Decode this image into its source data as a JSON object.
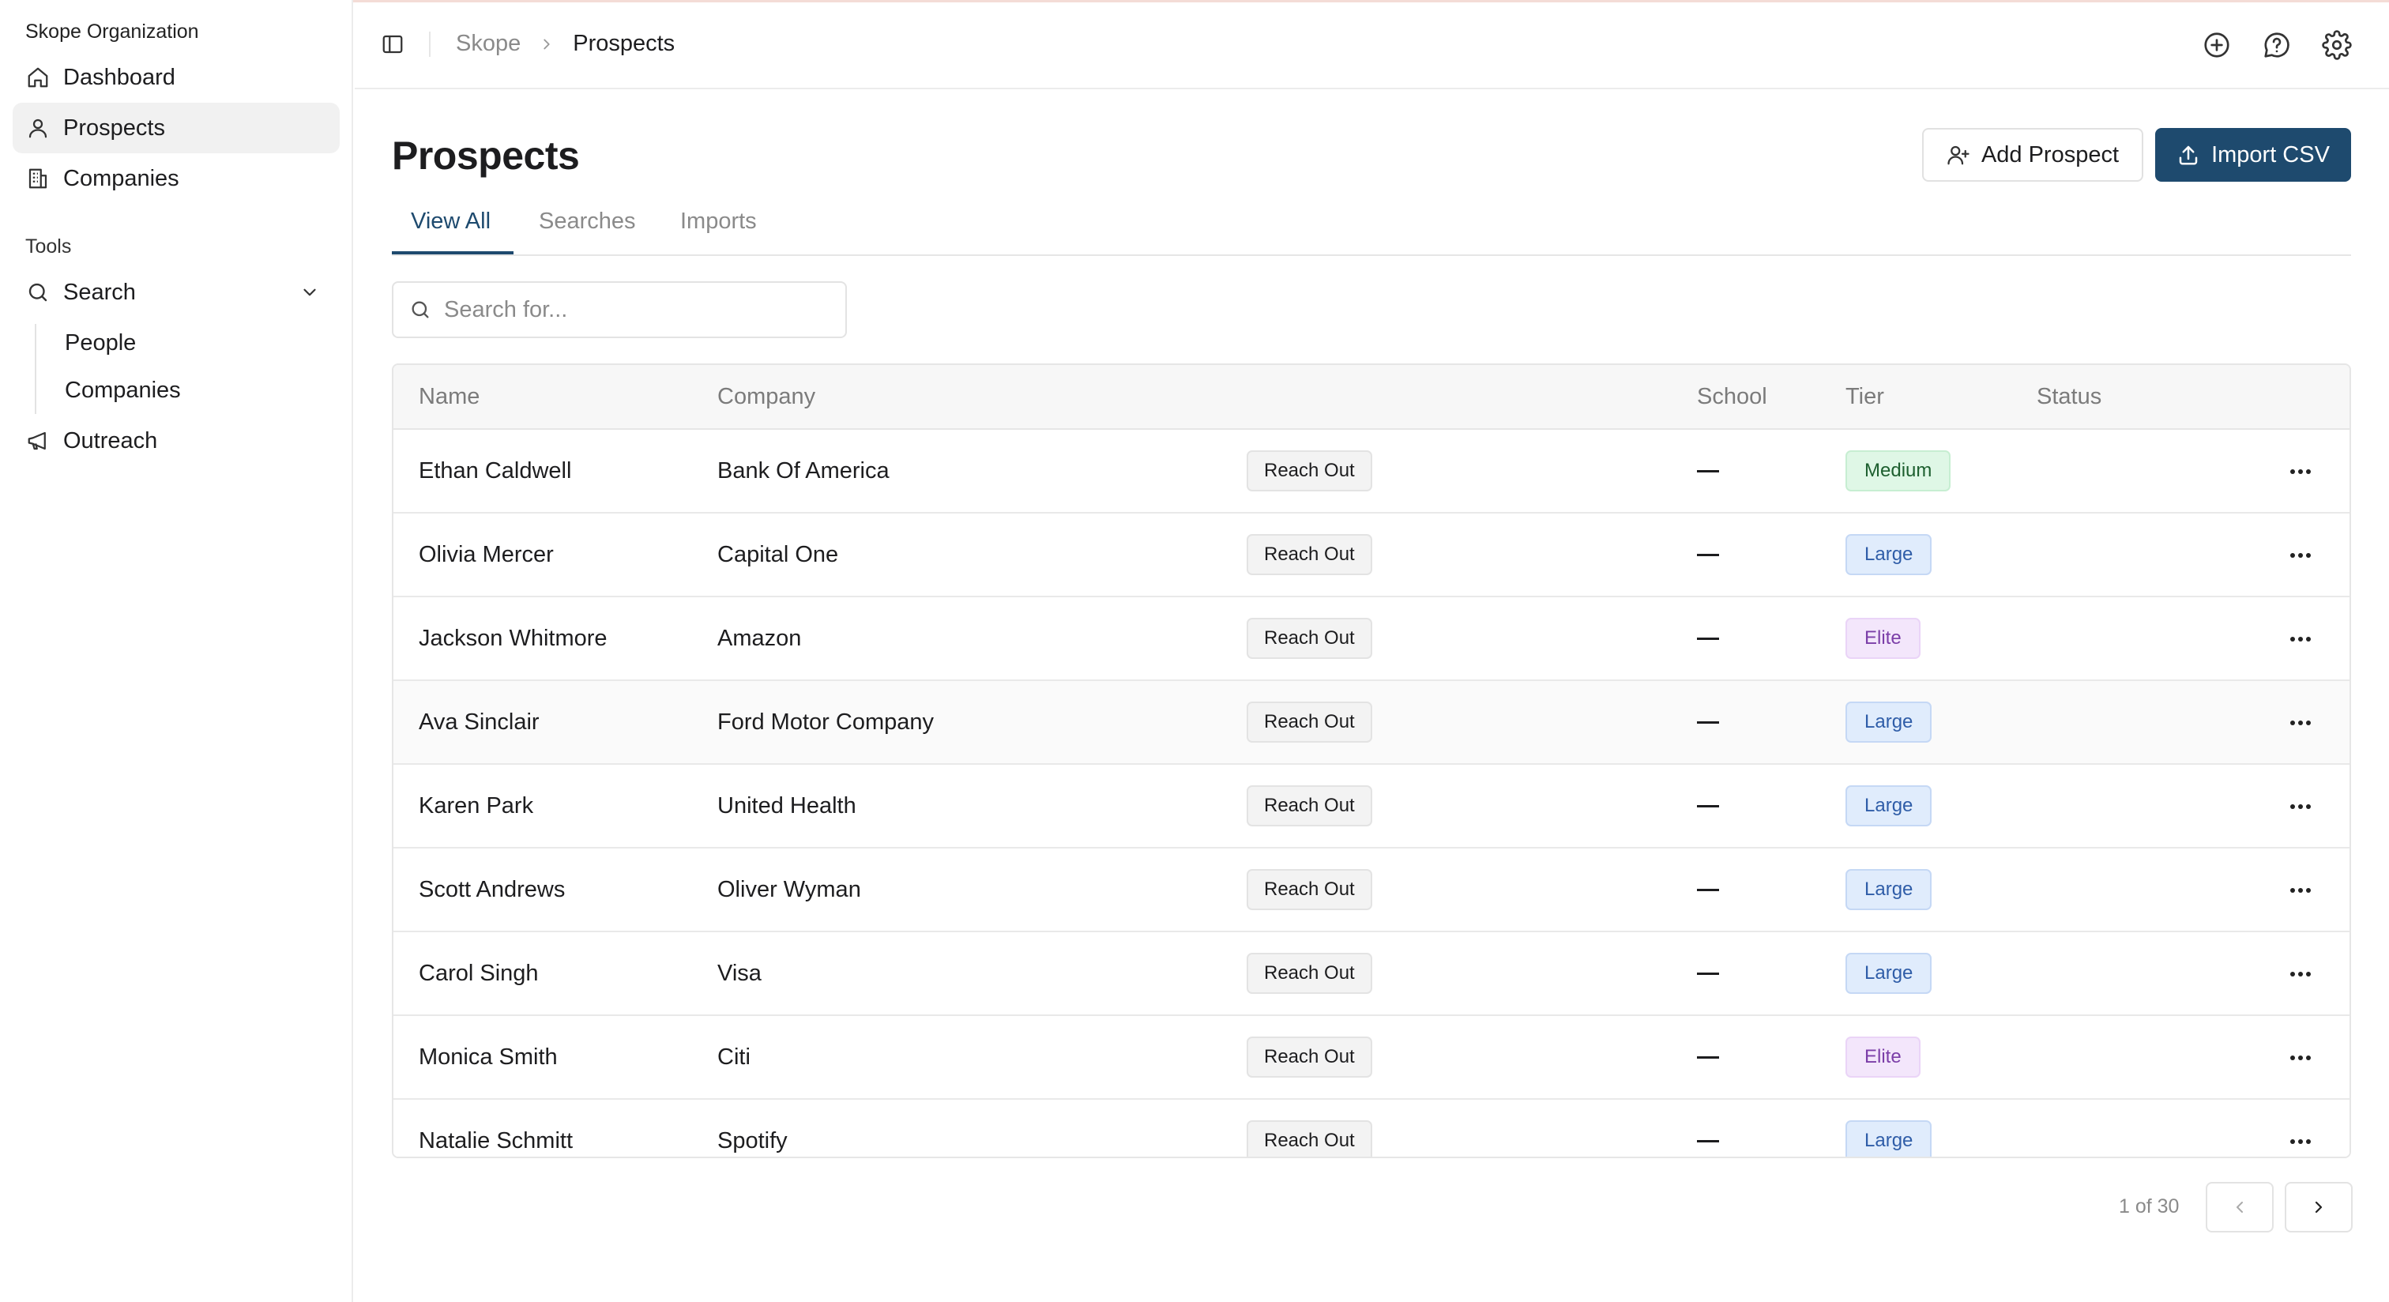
{
  "sidebar": {
    "org_name": "Skope Organization",
    "items": [
      {
        "label": "Dashboard",
        "icon": "home-icon"
      },
      {
        "label": "Prospects",
        "icon": "user-icon",
        "active": true
      },
      {
        "label": "Companies",
        "icon": "building-icon"
      }
    ],
    "tools_label": "Tools",
    "search": {
      "label": "Search",
      "icon": "search-icon",
      "expanded": true,
      "children": [
        "People",
        "Companies"
      ]
    },
    "outreach": {
      "label": "Outreach",
      "icon": "megaphone-icon"
    }
  },
  "header": {
    "breadcrumb": {
      "root": "Skope",
      "current": "Prospects"
    },
    "icons": [
      "add-circle-icon",
      "chat-help-icon",
      "settings-gear-icon"
    ]
  },
  "page": {
    "title": "Prospects",
    "add_button": "Add Prospect",
    "import_button": "Import CSV",
    "tabs": [
      {
        "label": "View All",
        "active": true
      },
      {
        "label": "Searches"
      },
      {
        "label": "Imports"
      }
    ],
    "search_placeholder": "Search for..."
  },
  "table": {
    "columns": [
      "Name",
      "Company",
      "School",
      "Tier",
      "Status"
    ],
    "rows": [
      {
        "name": "Ethan Caldwell",
        "company": "Bank Of America",
        "school": "—",
        "tier": "Medium",
        "status": "Reach Out"
      },
      {
        "name": "Olivia Mercer",
        "company": "Capital One",
        "school": "—",
        "tier": "Large",
        "status": "Reach Out"
      },
      {
        "name": "Jackson Whitmore",
        "company": "Amazon",
        "school": "—",
        "tier": "Elite",
        "status": "Reach Out"
      },
      {
        "name": "Ava Sinclair",
        "company": "Ford Motor Company",
        "school": "—",
        "tier": "Large",
        "status": "Reach Out"
      },
      {
        "name": "Karen Park",
        "company": "United Health",
        "school": "—",
        "tier": "Large",
        "status": "Reach Out"
      },
      {
        "name": "Scott Andrews",
        "company": "Oliver Wyman",
        "school": "—",
        "tier": "Large",
        "status": "Reach Out"
      },
      {
        "name": "Carol Singh",
        "company": "Visa",
        "school": "—",
        "tier": "Large",
        "status": "Reach Out"
      },
      {
        "name": "Monica Smith",
        "company": "Citi",
        "school": "—",
        "tier": "Elite",
        "status": "Reach Out"
      },
      {
        "name": "Natalie Schmitt",
        "company": "Spotify",
        "school": "—",
        "tier": "Large",
        "status": "Reach Out"
      }
    ]
  },
  "pagination": {
    "text": "1 of 30"
  },
  "colors": {
    "accent": "#1e4a6e",
    "tier_medium": "#dff7e6",
    "tier_large": "#e0ecfc",
    "tier_elite": "#f3e6fb"
  }
}
